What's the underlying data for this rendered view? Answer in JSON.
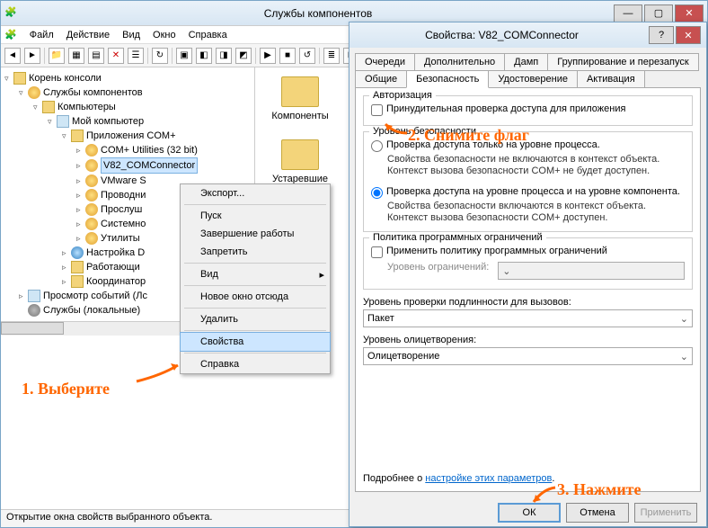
{
  "window": {
    "title": "Службы компонентов"
  },
  "menu": {
    "file": "Файл",
    "action": "Действие",
    "view": "Вид",
    "window": "Окно",
    "help": "Справка"
  },
  "tree": {
    "root": "Корень консоли",
    "services": "Службы компонентов",
    "computers": "Компьютеры",
    "my_computer": "Мой компьютер",
    "com_apps": "Приложения COM+",
    "apps": {
      "com_util": "COM+ Utilities (32 bit)",
      "v82": "V82_COMConnector",
      "vmware": "VMware S",
      "provodnik": "Проводни",
      "proslush": "Прослуш",
      "system": "Системно",
      "utility": "Утилиты",
      "nastroika": "Настройка D",
      "working": "Работающи",
      "coord": "Координатор"
    },
    "event_viewer": "Просмотр событий (Лс",
    "local_services": "Службы (локальные)"
  },
  "content_items": {
    "components": "Компоненты",
    "legacy": "Устаревшие"
  },
  "context_menu": {
    "export": "Экспорт...",
    "start": "Пуск",
    "shutdown": "Завершение работы",
    "disable": "Запретить",
    "view": "Вид",
    "new_window": "Новое окно отсюда",
    "delete": "Удалить",
    "properties": "Свойства",
    "help": "Справка"
  },
  "dialog": {
    "title": "Свойства: V82_COMConnector",
    "tabs": {
      "queues": "Очереди",
      "advanced": "Дополнительно",
      "dump": "Дамп",
      "grouping": "Группирование и перезапуск",
      "general": "Общие",
      "security": "Безопасность",
      "identity": "Удостоверение",
      "activation": "Активация"
    },
    "auth_group": "Авторизация",
    "force_check": "Принудительная проверка доступа для приложения",
    "sec_level_group": "Уровень безопасности",
    "radio1": "Проверка доступа только на уровне процесса.",
    "radio1_detail": "Свойства безопасности не включаются в контекст объекта. Контекст вызова безопасности COM+ не будет доступен.",
    "radio2": "Проверка доступа на уровне процесса и на уровне компонента.",
    "radio2_detail": "Свойства безопасности включаются в контекст объекта. Контекст вызова безопасности COM+ доступен.",
    "policy_group": "Политика программных ограничений",
    "apply_policy": "Применить  политику программных ограничений",
    "restriction_level": "Уровень ограничений:",
    "auth_level_label": "Уровень проверки подлинности для вызовов:",
    "auth_level_value": "Пакет",
    "impersonation_label": "Уровень олицетворения:",
    "impersonation_value": "Олицетворение",
    "more_info": "Подробнее о ",
    "more_link": "настройке этих параметров",
    "buttons": {
      "ok": "ОК",
      "cancel": "Отмена",
      "apply": "Применить"
    }
  },
  "annotations": {
    "a1": "1. Выберите",
    "a2": "2. Снимите флаг",
    "a3": "3. Нажмите"
  },
  "statusbar": "Открытие окна свойств выбранного объекта."
}
